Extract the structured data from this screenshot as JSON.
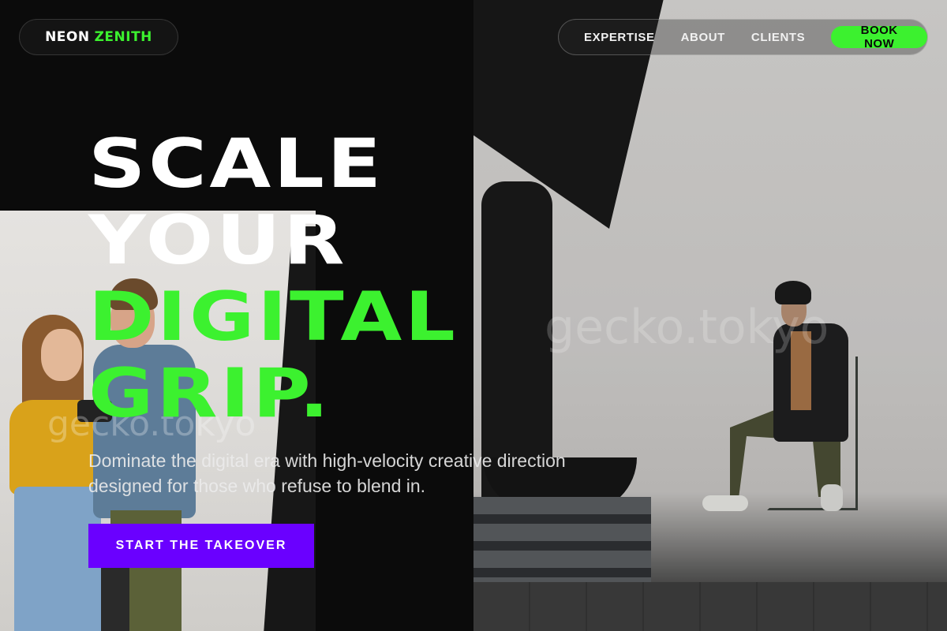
{
  "brand": {
    "part1": "NEON",
    "part2": "ZENITH"
  },
  "nav": {
    "links": [
      {
        "label": "EXPERTISE"
      },
      {
        "label": "ABOUT"
      },
      {
        "label": "CLIENTS"
      }
    ],
    "book_label": "BOOK NOW"
  },
  "hero": {
    "line1": "SCALE",
    "line2": "YOUR",
    "line3": "DIGITAL",
    "line4": "GRIP."
  },
  "subtitle": "Dominate the digital era with high-velocity creative direction designed for those who refuse to blend in.",
  "cta_label": "START THE TAKEOVER",
  "watermark": "gecko.tokyo",
  "colors": {
    "accent": "#3cf12f",
    "cta": "#6a00ff",
    "background": "#0b0b0b"
  }
}
